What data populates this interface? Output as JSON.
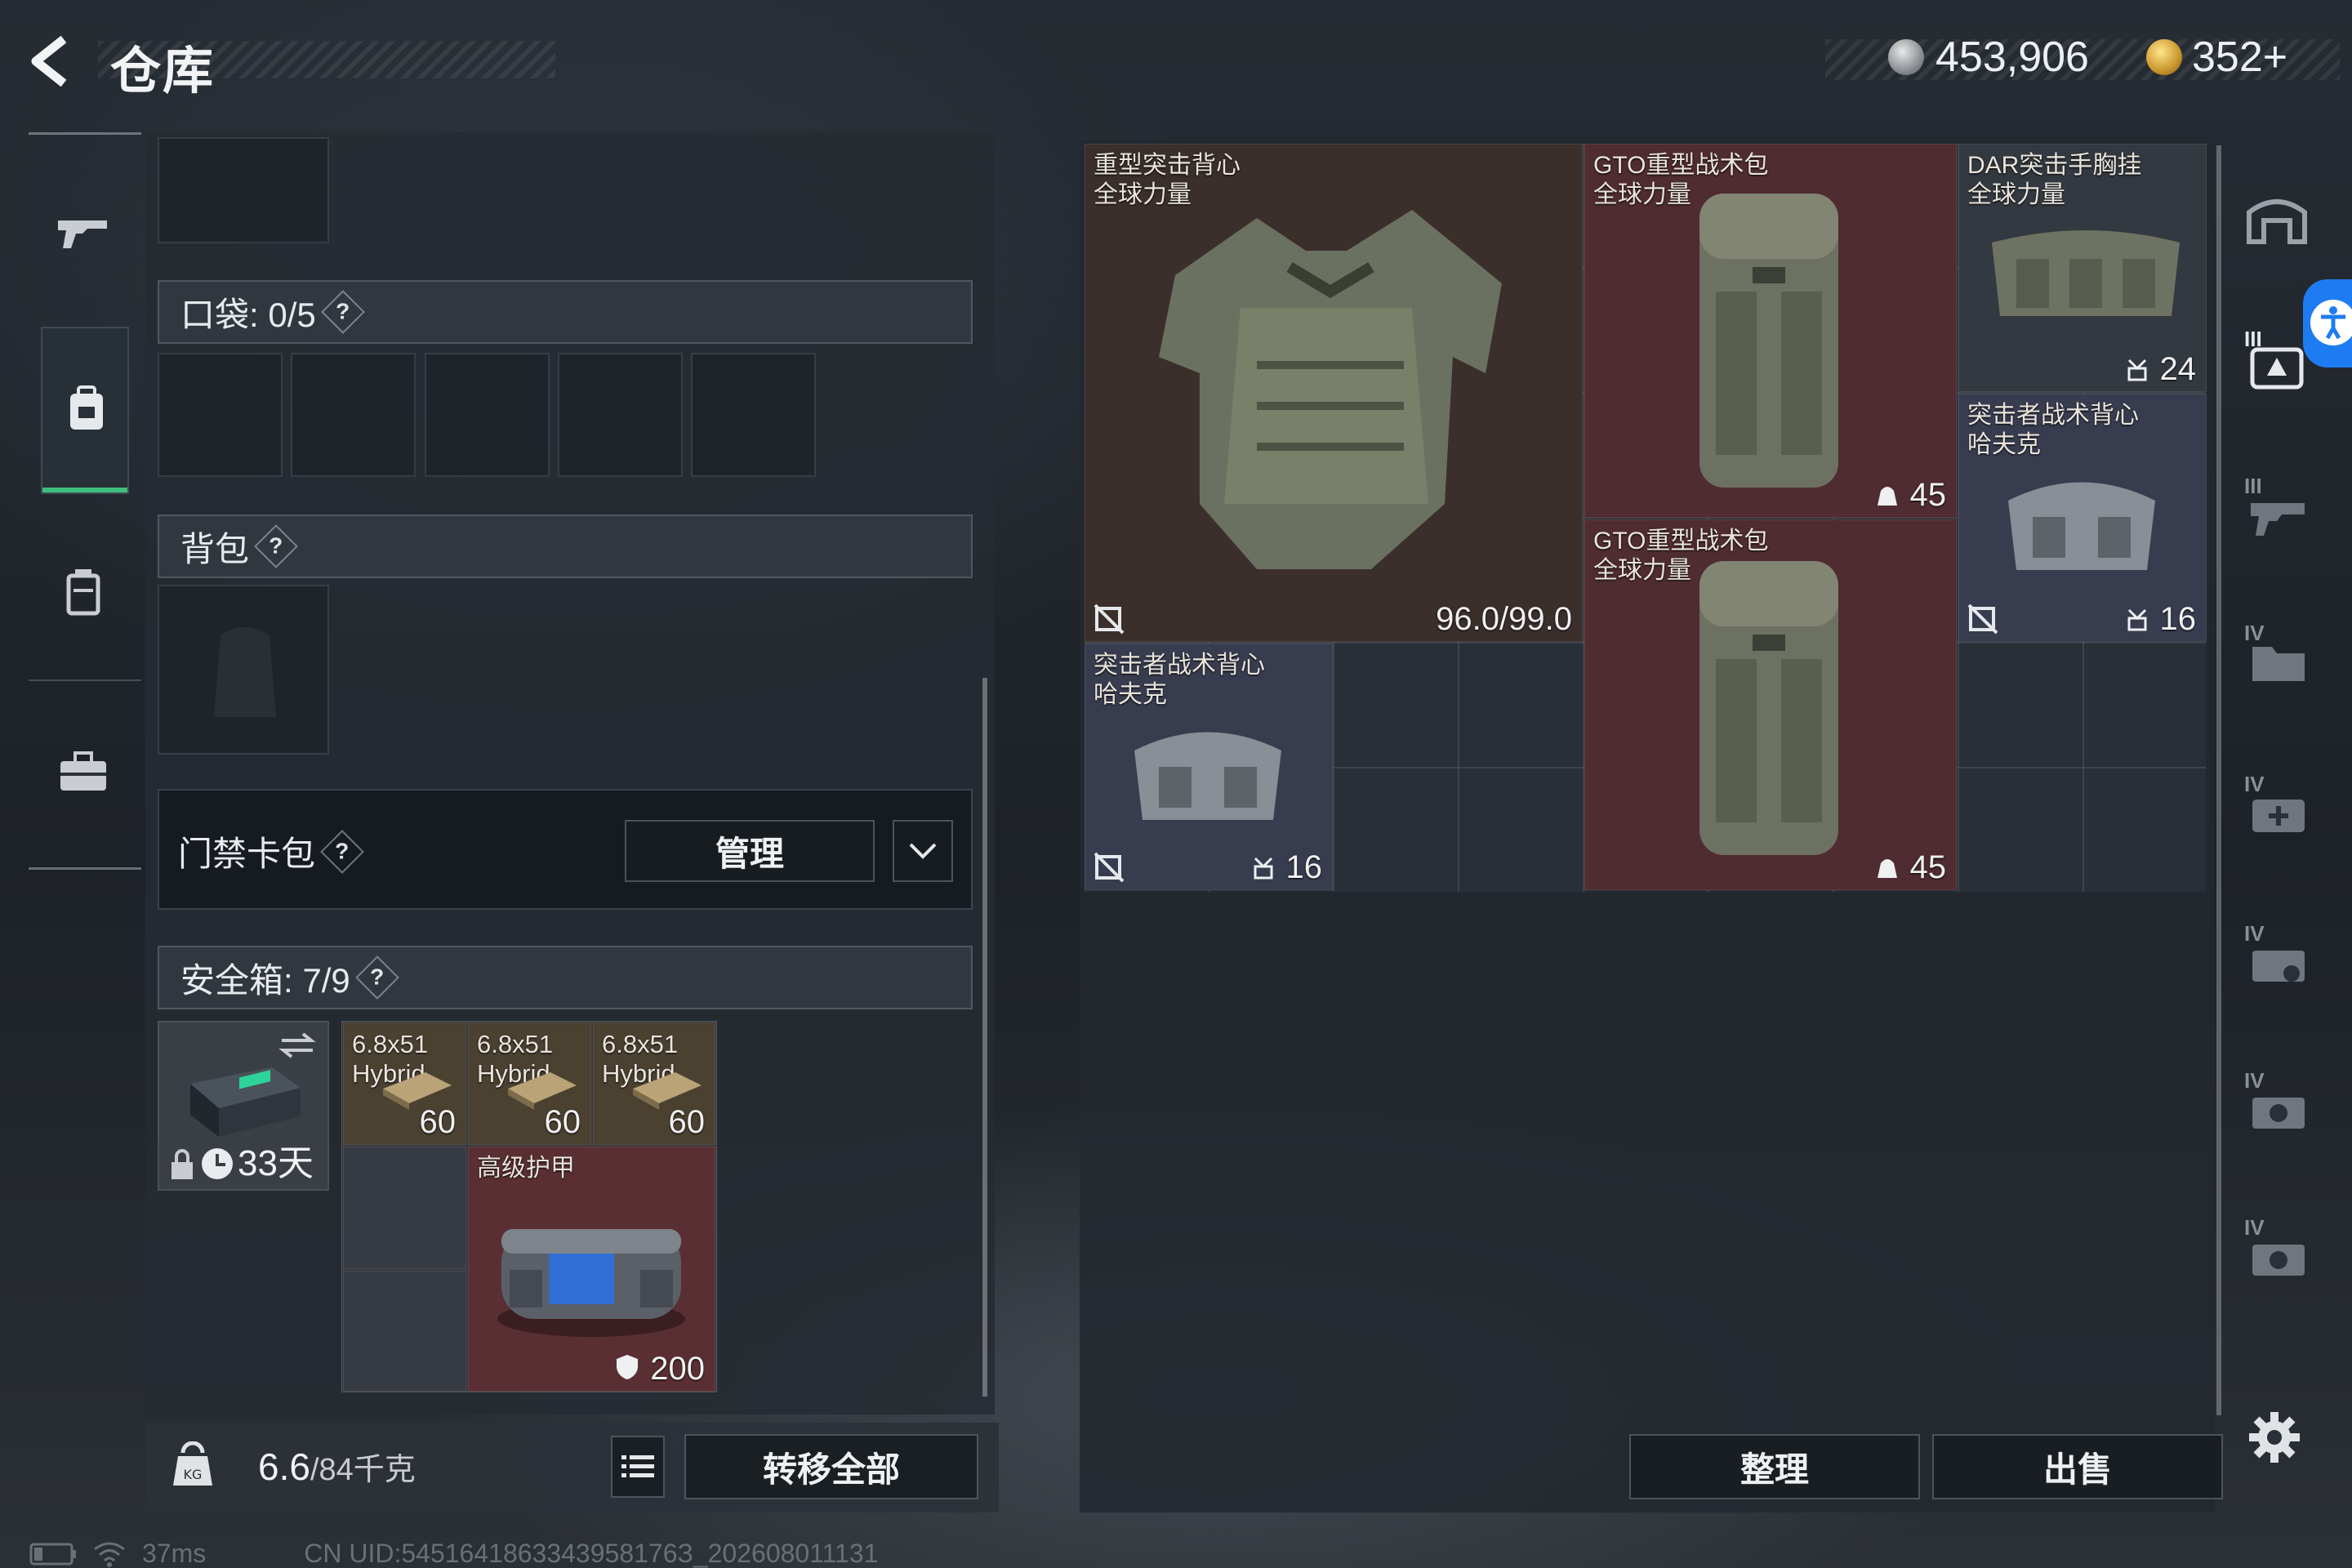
{
  "topbar": {
    "title": "仓库",
    "currency_1": "453,906",
    "currency_2": "352+"
  },
  "left": {
    "pocket_header": "口袋: 0/5",
    "backpack_header": "背包",
    "keycard_header": "门禁卡包",
    "manage_label": "管理",
    "safebox_header": "安全箱: 7/9",
    "safebox_days": "33天",
    "ammo": [
      {
        "name": "6.8x51",
        "sub": "Hybrid",
        "count": "60"
      },
      {
        "name": "6.8x51",
        "sub": "Hybrid",
        "count": "60"
      },
      {
        "name": "6.8x51",
        "sub": "Hybrid",
        "count": "60"
      }
    ],
    "armor_item": {
      "name": "高级护甲",
      "value": "200"
    },
    "weight_value": "6.6",
    "weight_total": "/84千克",
    "transfer_all_label": "转移全部"
  },
  "stash": {
    "items": [
      {
        "name": "重型突击背心",
        "brand": "全球力量",
        "value": "96.0/99.0"
      },
      {
        "name": "GTO重型战术包",
        "brand": "全球力量",
        "value": "45"
      },
      {
        "name": "DAR突击手胸挂",
        "brand": "全球力量",
        "value": "24"
      },
      {
        "name": "突击者战术背心",
        "brand": "哈夫克",
        "value": "16"
      },
      {
        "name": "GTO重型战术包",
        "brand": "全球力量",
        "value": "45"
      },
      {
        "name": "突击者战术背心",
        "brand": "哈夫克",
        "value": "16"
      }
    ],
    "sort_label": "整理",
    "sell_label": "出售"
  },
  "right_rail": {
    "tab_labels": [
      "III",
      "III",
      "IV",
      "IV",
      "IV",
      "IV",
      "IV"
    ]
  },
  "status": {
    "ping": "37ms",
    "uid": "CN UID:5451641863343958176З_202608011131"
  },
  "colors": {
    "accent_green": "#3fbf7f",
    "item_red": "#5a2f33",
    "accessibility_blue": "#1e7cf2"
  }
}
